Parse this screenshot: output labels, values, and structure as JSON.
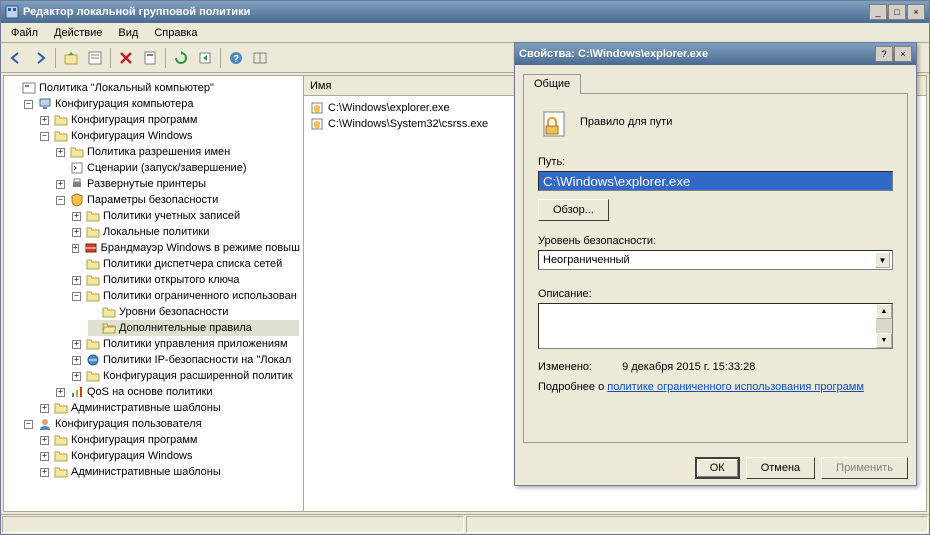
{
  "window": {
    "title": "Редактор локальной групповой политики",
    "minimize": "_",
    "maximize": "□",
    "close": "×"
  },
  "menu": {
    "file": "Файл",
    "action": "Действие",
    "view": "Вид",
    "help": "Справка"
  },
  "tree": {
    "root": "Политика \"Локальный компьютер\"",
    "computer_config": "Конфигурация компьютера",
    "software_settings": "Конфигурация программ",
    "windows_settings": "Конфигурация Windows",
    "name_resolution": "Политика разрешения имен",
    "scripts": "Сценарии (запуск/завершение)",
    "printers": "Развернутые принтеры",
    "security": "Параметры безопасности",
    "account_policies": "Политики учетных записей",
    "local_policies": "Локальные политики",
    "firewall": "Брандмауэр Windows в режиме повыш",
    "nlm": "Политики диспетчера списка сетей",
    "pubkey": "Политики открытого ключа",
    "srp": "Политики ограниченного использован",
    "security_levels": "Уровни безопасности",
    "additional_rules": "Дополнительные правила",
    "app_control": "Политики управления приложениям",
    "ipsec": "Политики IP-безопасности на \"Локал",
    "audit": "Конфигурация расширенной политик",
    "qos": "QoS на основе политики",
    "admin_templates": "Административные шаблоны",
    "user_config": "Конфигурация пользователя",
    "u_software": "Конфигурация программ",
    "u_windows": "Конфигурация Windows",
    "u_admin": "Административные шаблоны"
  },
  "list": {
    "header": "Имя",
    "item1": "C:\\Windows\\explorer.exe",
    "item2": "C:\\Windows\\System32\\csrss.exe"
  },
  "dialog": {
    "title": "Свойства: C:\\Windows\\explorer.exe",
    "help": "?",
    "close": "×",
    "tab_general": "Общие",
    "rule_type": "Правило для пути",
    "path_label": "Путь:",
    "path_value": "C:\\Windows\\explorer.exe",
    "browse": "Обзор...",
    "level_label": "Уровень безопасности:",
    "level_value": "Неограниченный",
    "desc_label": "Описание:",
    "modified_label": "Изменено:",
    "modified_value": "9 декабря 2015 г.  15:33:28",
    "learn_more": "Подробнее о ",
    "learn_more_link": "политике ограниченного использования программ",
    "ok": "ОК",
    "cancel": "Отмена",
    "apply": "Применить"
  }
}
